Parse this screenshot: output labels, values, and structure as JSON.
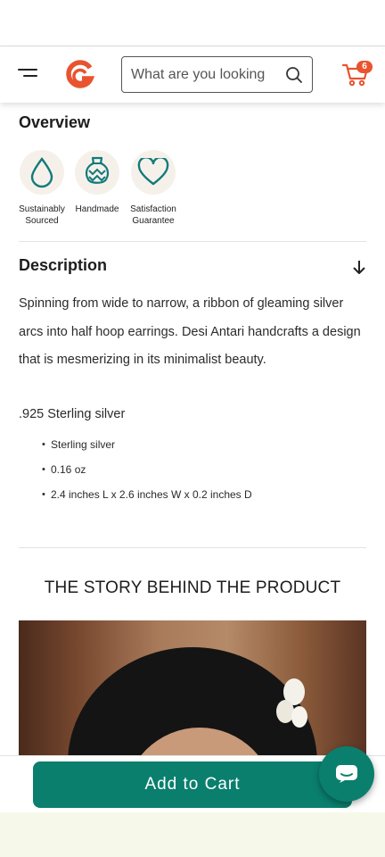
{
  "header": {
    "search_placeholder": "What are you looking",
    "cart_count": "6"
  },
  "overview": {
    "title": "Overview",
    "features": [
      {
        "label_line1": "Sustainably",
        "label_line2": "Sourced",
        "icon": "water-drop-icon"
      },
      {
        "label_line1": "Handmade",
        "label_line2": "",
        "icon": "vase-icon"
      },
      {
        "label_line1": "Satisfaction",
        "label_line2": "Guarantee",
        "icon": "heart-icon"
      }
    ]
  },
  "description": {
    "title": "Description",
    "body": "Spinning from wide to narrow, a ribbon of gleaming silver arcs into half hoop earrings. Desi Antari handcrafts a design that is mesmerizing in its minimalist beauty.",
    "material": ".925 Sterling silver",
    "specs": [
      "Sterling silver",
      "0.16 oz",
      "2.4 inches L x 2.6 inches W x 0.2 inches D"
    ]
  },
  "story": {
    "title": "THE STORY BEHIND THE PRODUCT"
  },
  "actions": {
    "add_to_cart": "Add to Cart"
  },
  "colors": {
    "brand_orange": "#e8542f",
    "accent_teal": "#0a7f6e",
    "icon_teal": "#137a7a"
  }
}
